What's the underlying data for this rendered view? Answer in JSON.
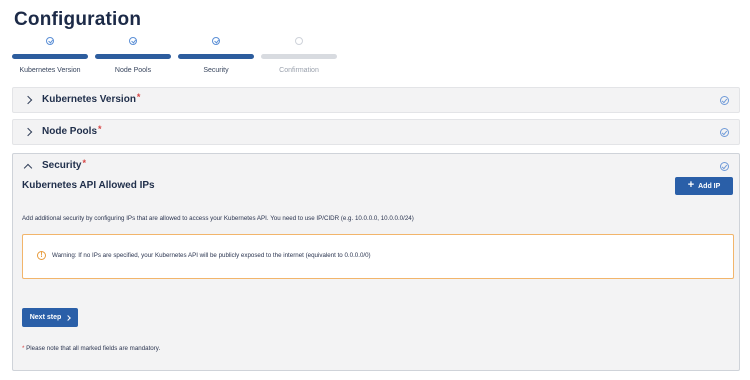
{
  "page": {
    "title": "Configuration"
  },
  "stepper": {
    "steps": [
      {
        "label": "Kubernetes Version",
        "status": "completed"
      },
      {
        "label": "Node Pools",
        "status": "completed"
      },
      {
        "label": "Security",
        "status": "completed"
      },
      {
        "label": "Confirmation",
        "status": "pending"
      }
    ]
  },
  "panels": {
    "kubernetes_version": {
      "title": "Kubernetes Version",
      "required_mark": "*",
      "expanded": false
    },
    "node_pools": {
      "title": "Node Pools",
      "required_mark": "*",
      "expanded": false
    },
    "security": {
      "title": "Security",
      "required_mark": "*",
      "expanded": true,
      "section_title": "Kubernetes API Allowed IPs",
      "add_ip_label": "Add IP",
      "description": "Add additional security by configuring IPs that are allowed to access your Kubernetes API. You need to use IP/CIDR (e.g. 10.0.0.0, 10.0.0.0/24)",
      "warning_icon": "!",
      "warning": "Warning: If no IPs are specified, your Kubernetes API will be publicly exposed to the internet (equivalent to 0.0.0.0/0)",
      "next_step_label": "Next step",
      "mandatory_mark": "*",
      "mandatory_note": " Please note that all marked fields are mandatory."
    }
  },
  "icons": {
    "expand": "chevron-right-icon",
    "collapse": "chevron-up-icon",
    "done": "check-circle-icon",
    "warning": "warning-circle-icon",
    "add": "plus-icon",
    "next": "chevron-right-icon"
  },
  "colors": {
    "accent": "#2a5fa8",
    "step_active": "#2d5d9e",
    "step_pending": "#d8dbe0",
    "warning_border": "#f2b56b",
    "required": "#d64545"
  }
}
